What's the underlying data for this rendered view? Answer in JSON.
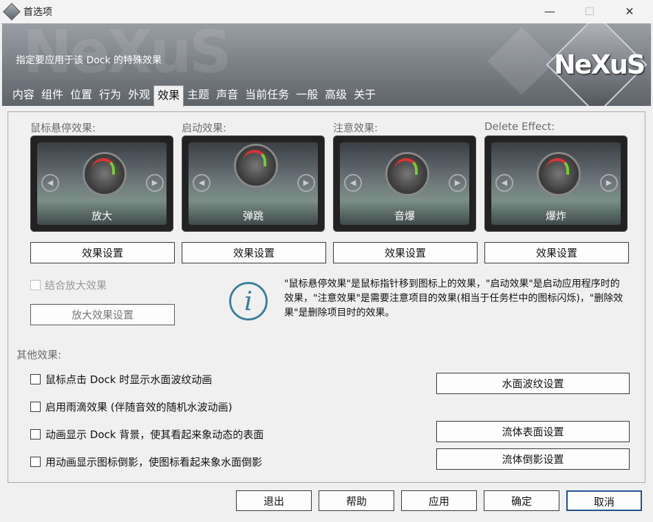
{
  "window": {
    "title": "首选项",
    "minimize": "—",
    "maximize": "☐",
    "close": "✕"
  },
  "banner": {
    "description": "指定要应用于该 Dock 的特殊效果",
    "logo": "NeXuS"
  },
  "tabs": [
    "内容",
    "组件",
    "位置",
    "行为",
    "外观",
    "效果",
    "主题",
    "声音",
    "当前任务",
    "一般",
    "高级",
    "关于"
  ],
  "active_tab": "效果",
  "effects": [
    {
      "label": "鼠标悬停效果:",
      "selected": "放大",
      "settings": "效果设置"
    },
    {
      "label": "启动效果:",
      "selected": "弹跳",
      "settings": "效果设置"
    },
    {
      "label": "注意效果:",
      "selected": "音爆",
      "settings": "效果设置"
    },
    {
      "label": "Delete Effect:",
      "selected": "爆炸",
      "settings": "效果设置"
    }
  ],
  "combine_zoom": {
    "label": "结合放大效果",
    "checked": false,
    "enabled": false
  },
  "zoom_settings": "放大效果设置",
  "info": "\"鼠标悬停效果\"是鼠标指针移到图标上的效果，\"启动效果\"是启动应用程序时的效果，\"注意效果\"是需要注意项目的效果(相当于任务栏中的图标闪烁)，\"删除效果\"是删除项目时的效果。",
  "other_effects": {
    "heading": "其他效果:",
    "options": [
      {
        "label": "鼠标点击 Dock 时显示水面波纹动画",
        "checked": false
      },
      {
        "label": "启用雨滴效果 (伴随音效的随机水波动画)",
        "checked": false
      },
      {
        "label": "动画显示 Dock 背景，使其看起来象动态的表面",
        "checked": false
      },
      {
        "label": "用动画显示图标倒影，使图标看起来象水面倒影",
        "checked": false
      }
    ],
    "buttons": [
      "水面波纹设置",
      "流体表面设置",
      "流体倒影设置"
    ]
  },
  "footer": [
    "退出",
    "帮助",
    "应用",
    "确定",
    "取消"
  ],
  "arrows": {
    "prev": "◀",
    "next": "▶"
  },
  "icons": {
    "info": "i"
  }
}
